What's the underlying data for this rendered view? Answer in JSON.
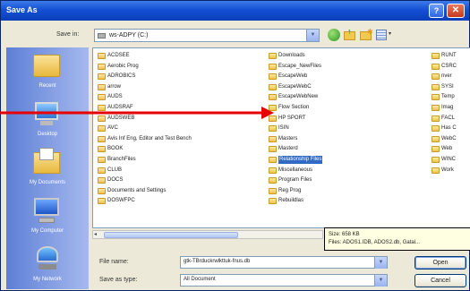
{
  "window": {
    "title": "Save As"
  },
  "title_buttons": {
    "help": "?",
    "close": "✕"
  },
  "save_in": {
    "label": "Save in:",
    "value": "ws-ADPY (C:)"
  },
  "places": [
    {
      "label": "Recent"
    },
    {
      "label": "Desktop"
    },
    {
      "label": "My Documents"
    },
    {
      "label": "My Computer"
    },
    {
      "label": "My Network"
    }
  ],
  "files": {
    "col1": [
      "ACDSEE",
      "Aerobic Prog",
      "ADROBICS",
      "arrow",
      "AUDS",
      "AUDSRAF",
      "AUDSWEB",
      "AVC",
      "Avis Inf Eng, Editor and Test Bench",
      "BOOK",
      "BranchFiles",
      "CLUB",
      "DOCS",
      "Documents and Settings",
      "DOSWFPC"
    ],
    "col2": [
      "Downloads",
      "Escape_NewFiles",
      "EscapeWeb",
      "EscapeWebC",
      "EscapeWebNew",
      "Flow Section",
      "HP SPORT",
      "ISIN",
      "Masters",
      "Masterd",
      "Relationship Files",
      "Miscellaneous",
      "Program Files",
      "Reg Prog",
      "Rebuildlas"
    ],
    "col3": [
      "RUNT",
      "CSRC",
      "nver",
      "SYSI",
      "Temp",
      "Imag",
      "FACL",
      "Has C",
      "WebC",
      "Web",
      "WINC",
      "Work"
    ],
    "selected": "Relationship Files"
  },
  "tooltip": {
    "size": "Size: 658 KB",
    "files": "Files: ADOS1.IDB, ADOS2.db, Gatal..."
  },
  "file_name": {
    "label": "File name:",
    "value": "gtk-TBrduckrwlkttuk-fnus.db"
  },
  "save_type": {
    "label": "Save as type:",
    "value": "All Document"
  },
  "buttons": {
    "open": "Open",
    "cancel": "Cancel"
  },
  "colors": {
    "titlebar": "#1450d4",
    "selection": "#316ac5",
    "pointer": "#e60000"
  }
}
